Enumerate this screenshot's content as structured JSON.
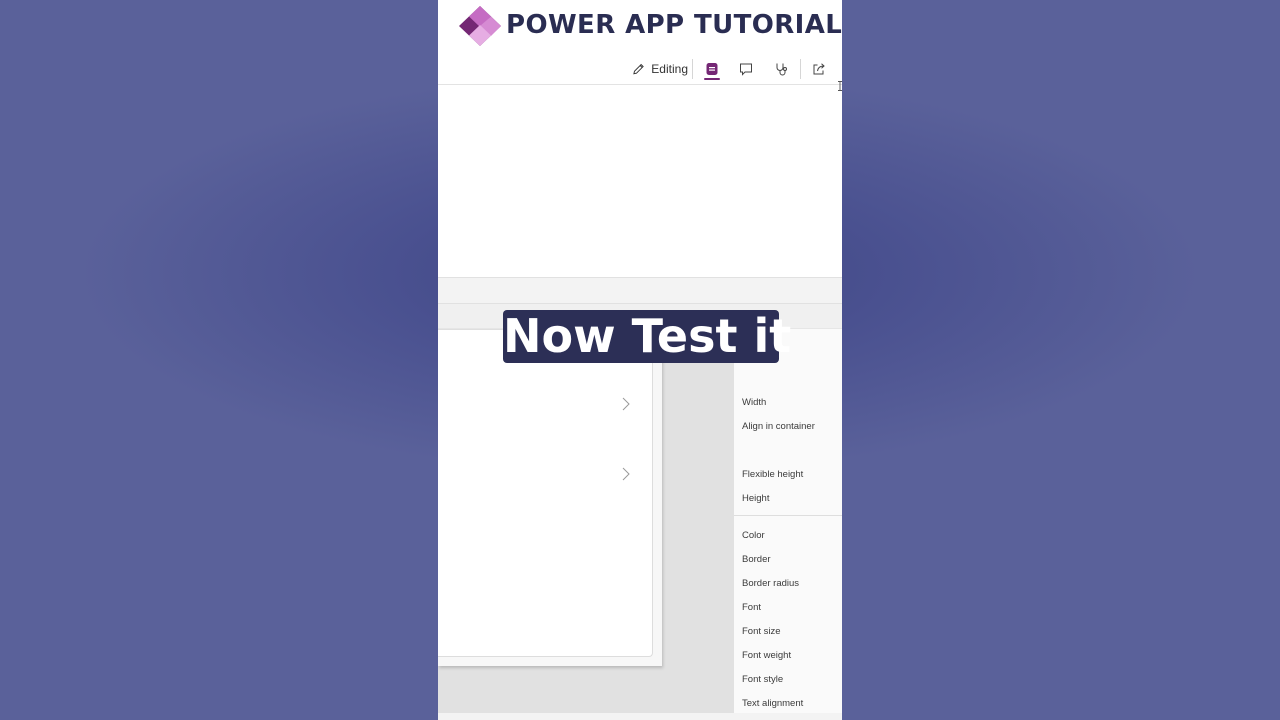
{
  "brand": {
    "title": "POWER APP TUTORIAL",
    "colors": {
      "title": "#2a2d52",
      "logo_dark": "#742774",
      "logo_light": "#d17fcf"
    }
  },
  "toolbar": {
    "edit_label": "Editing",
    "icons": [
      "pencil-icon",
      "app-icon",
      "comment-icon",
      "stethoscope-icon",
      "share-icon"
    ],
    "active_color": "#742774"
  },
  "properties": {
    "layout": [
      "Width",
      "Align in container",
      "Flexible height",
      "Height"
    ],
    "style": [
      "Color",
      "Border",
      "Border radius",
      "Font",
      "Font size",
      "Font weight",
      "Font style",
      "Text alignment"
    ]
  },
  "caption": {
    "text": "Now Test it",
    "background": "#2c2f56"
  }
}
